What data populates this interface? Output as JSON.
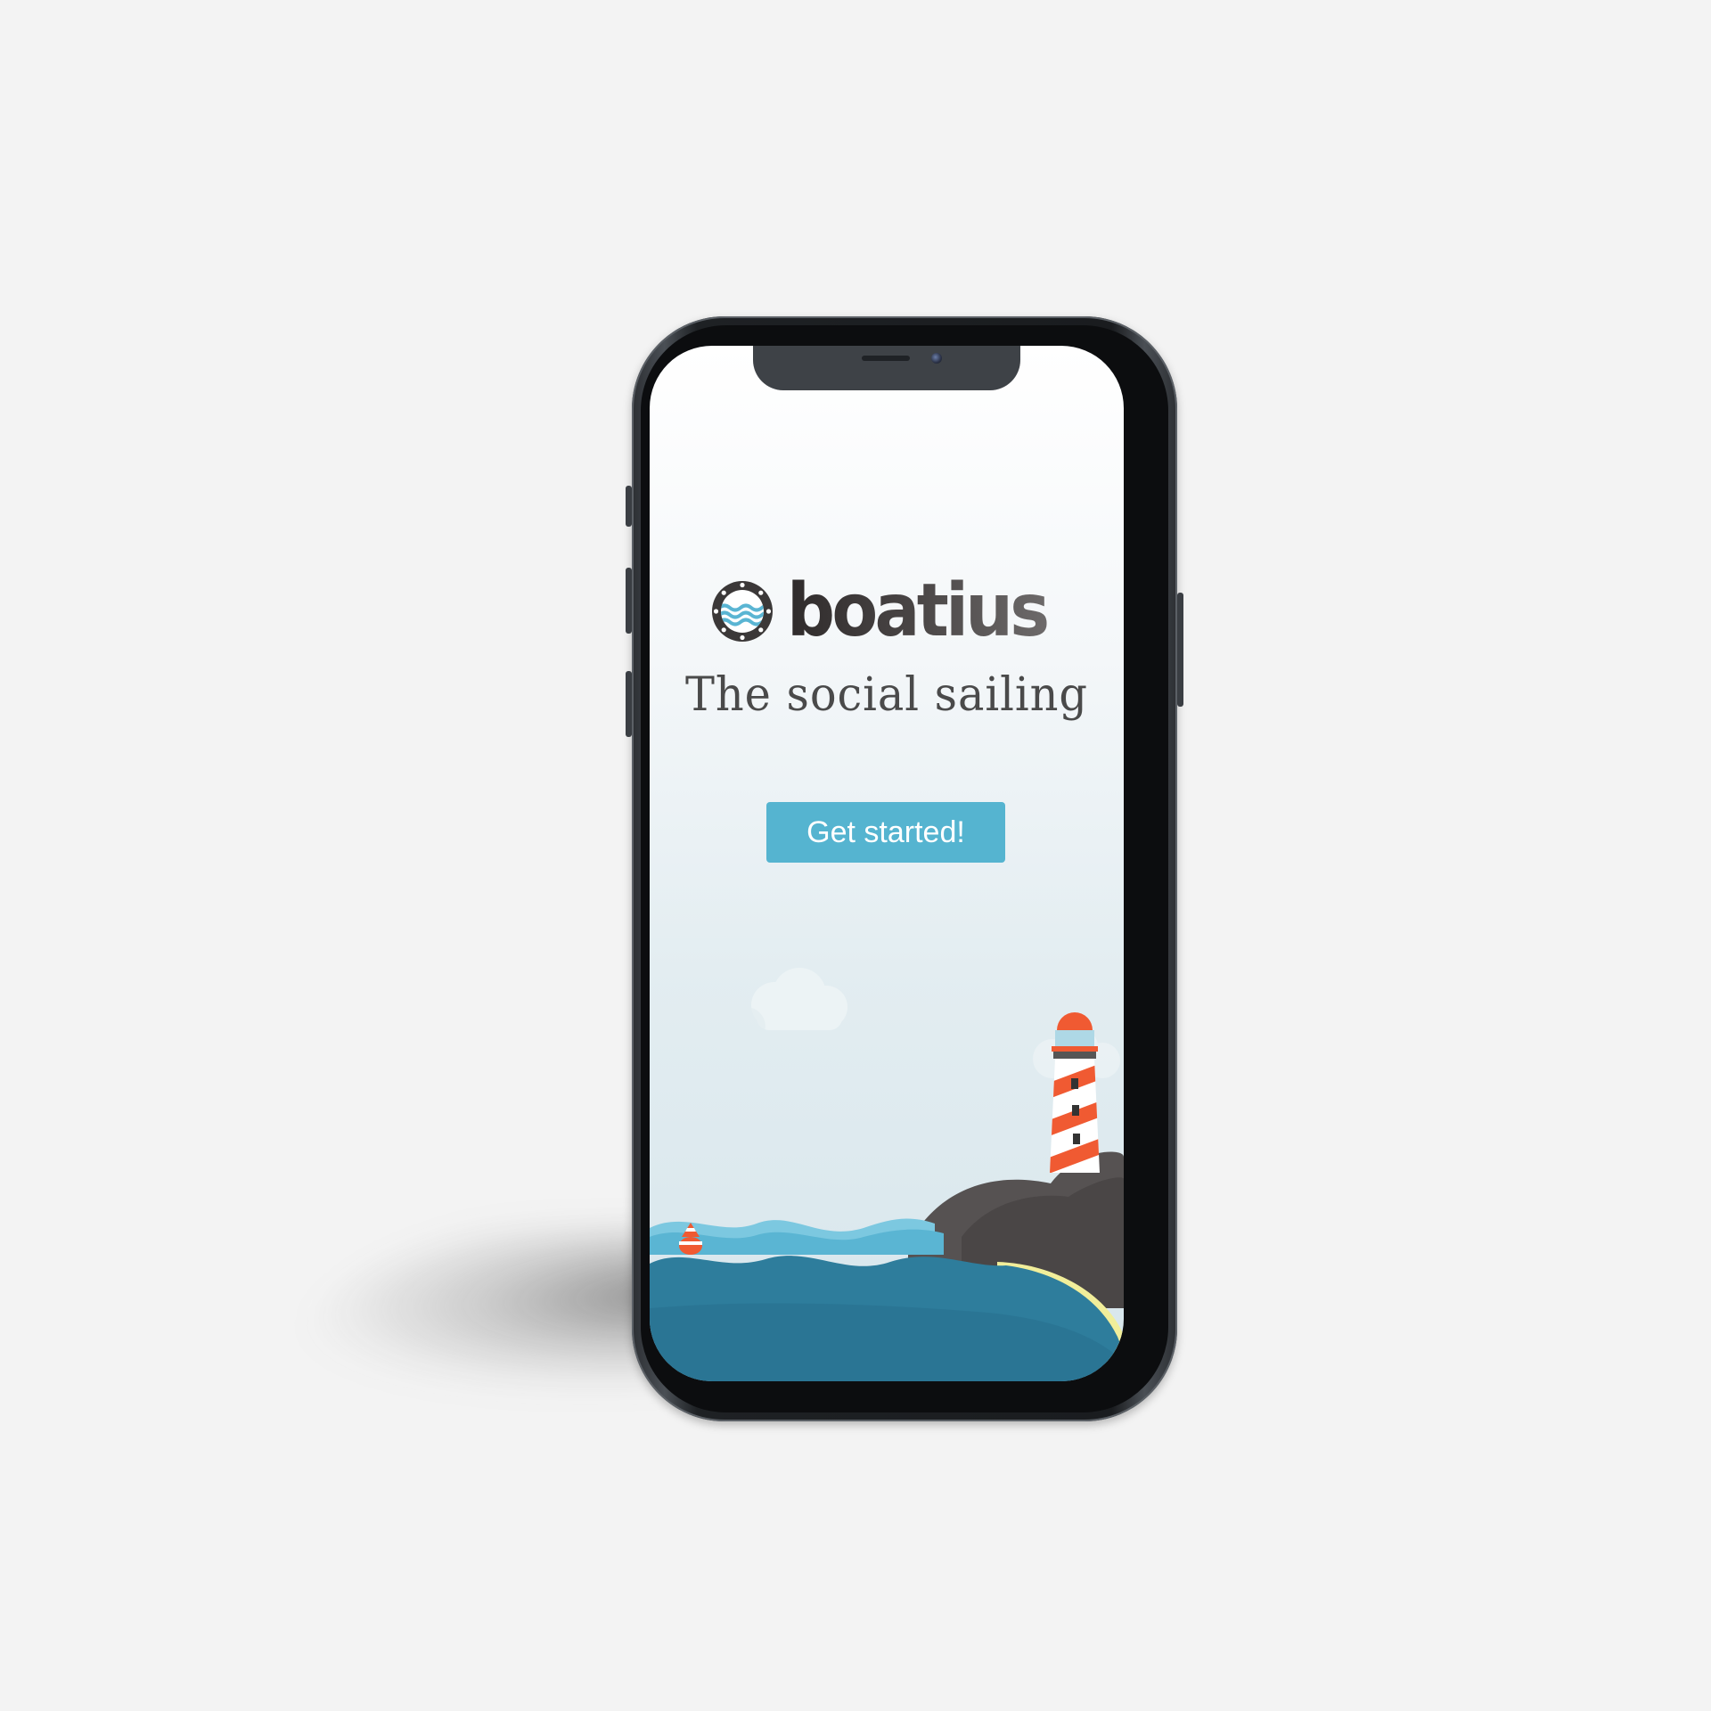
{
  "app": {
    "name": "boatius",
    "tagline": "The social sailing"
  },
  "actions": {
    "get_started_label": "Get started!"
  },
  "icons": {
    "logo": "porthole-icon",
    "illustration": [
      "cloud-icon",
      "lighthouse-icon",
      "buoy-icon",
      "rocks-icon",
      "waves-icon"
    ]
  },
  "colors": {
    "background": "#f3f3f3",
    "phone_frame": "#1e2124",
    "brand_text": "#3d3a3a",
    "accent": "#55b4d0",
    "button_text": "#ffffff",
    "sea_dark": "#2b7594",
    "sea_light": "#7cc8e0",
    "rock": "#565252",
    "lighthouse_red": "#f05a32",
    "sand": "#f1ee9a"
  }
}
